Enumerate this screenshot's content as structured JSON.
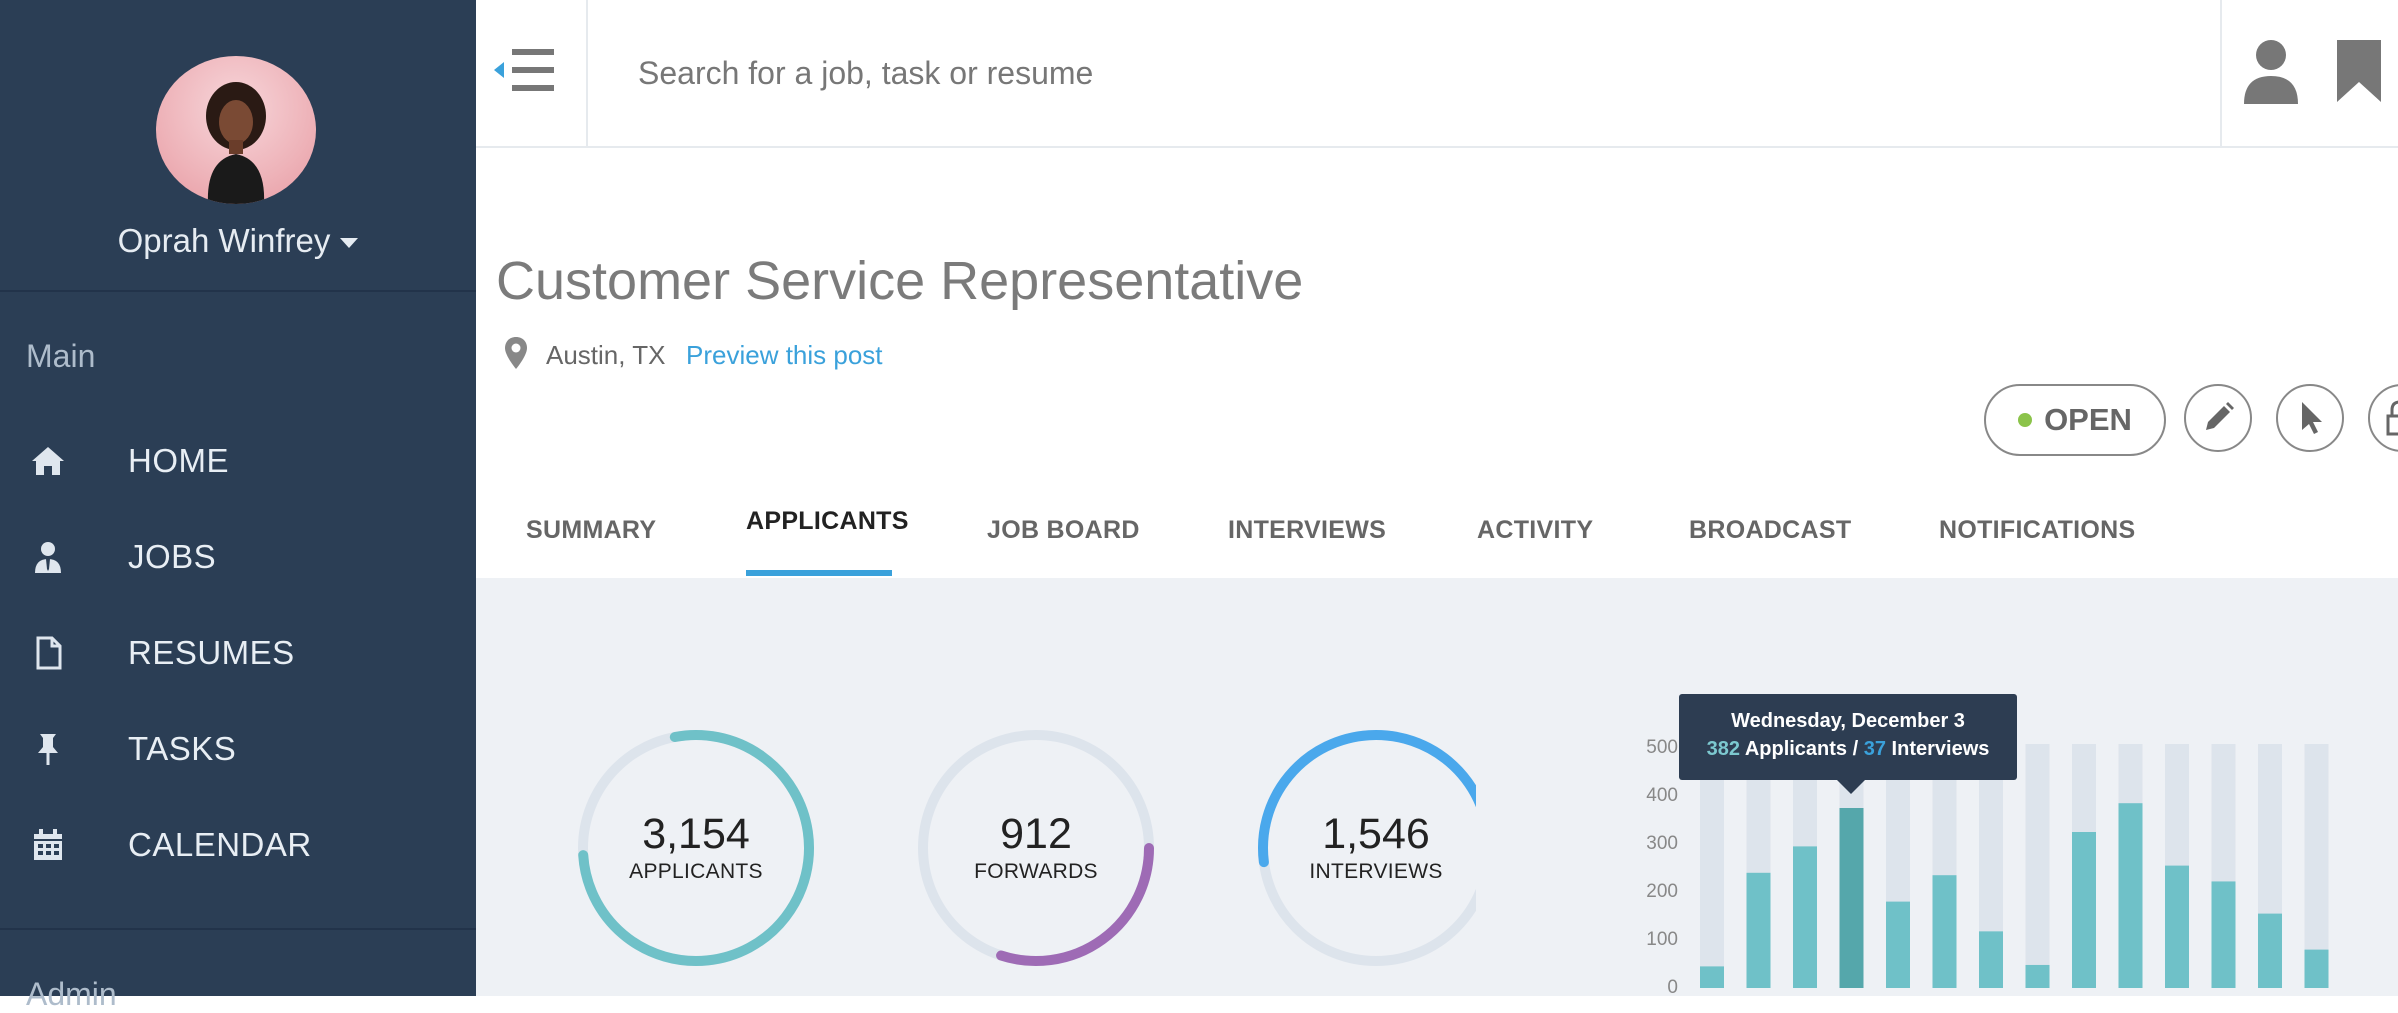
{
  "sidebar": {
    "user_name": "Oprah Winfrey",
    "section_main": "Main",
    "section_admin": "Admin",
    "items": [
      {
        "label": "HOME",
        "icon": "home-icon"
      },
      {
        "label": "JOBS",
        "icon": "user-tie-icon"
      },
      {
        "label": "RESUMES",
        "icon": "document-icon"
      },
      {
        "label": "TASKS",
        "icon": "pin-icon"
      },
      {
        "label": "CALENDAR",
        "icon": "calendar-icon"
      }
    ]
  },
  "topbar": {
    "search_placeholder": "Search for a job, task or resume"
  },
  "job": {
    "title": "Customer Service Representative",
    "location": "Austin, TX",
    "preview_link": "Preview this post",
    "status": "OPEN"
  },
  "tabs": [
    {
      "label": "SUMMARY"
    },
    {
      "label": "APPLICANTS"
    },
    {
      "label": "JOB BOARD"
    },
    {
      "label": "INTERVIEWS"
    },
    {
      "label": "ACTIVITY"
    },
    {
      "label": "BROADCAST"
    },
    {
      "label": "NOTIFICATIONS"
    }
  ],
  "active_tab": "APPLICANTS",
  "colors": {
    "accent": "#3aa1db",
    "applicants": "#6fc1c8",
    "forwards": "#9e6bb5",
    "interviews": "#4aa8ec",
    "sidebar_bg": "#2b3e55"
  },
  "stats": [
    {
      "value": "3,154",
      "label": "APPLICANTS",
      "fraction": 0.77
    },
    {
      "value": "912",
      "label": "FORWARDS",
      "fraction": 0.3
    },
    {
      "value": "1,546",
      "label": "INTERVIEWS",
      "fraction": 0.52
    }
  ],
  "chart_data": {
    "type": "bar",
    "ylim": [
      0,
      500
    ],
    "yticks": [
      0,
      100,
      200,
      300,
      400,
      500
    ],
    "series": [
      {
        "values": [
          45,
          240,
          295,
          375,
          180,
          235,
          118,
          48,
          325,
          385,
          255,
          222,
          155,
          80
        ]
      }
    ],
    "highlight_index": 3,
    "tooltip": {
      "date": "Wednesday, December 3",
      "applicants": "382",
      "applicants_label": "Applicants /",
      "interviews": "37",
      "interviews_label": "Interviews"
    }
  }
}
